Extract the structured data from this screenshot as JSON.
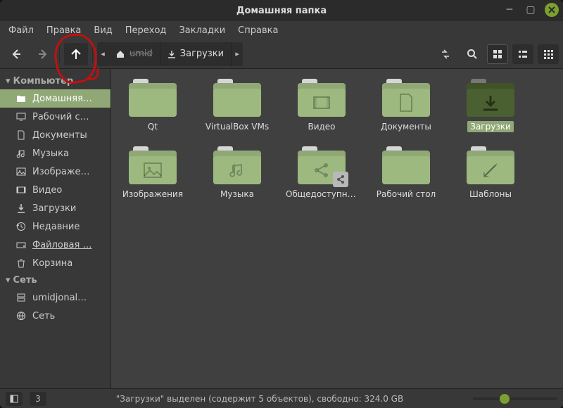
{
  "title": "Домашняя папка",
  "menu": {
    "file": "Файл",
    "edit": "Правка",
    "view": "Вид",
    "go": "Переход",
    "bookmarks": "Закладки",
    "help": "Справка"
  },
  "path": {
    "home_label": "",
    "downloads_label": "Загрузки"
  },
  "sidebar": {
    "computer_label": "Компьютер",
    "network_label": "Сеть",
    "items": [
      {
        "label": "Домашняя…",
        "icon": "folder",
        "active": true
      },
      {
        "label": "Рабочий с…",
        "icon": "desktop"
      },
      {
        "label": "Документы",
        "icon": "document"
      },
      {
        "label": "Музыка",
        "icon": "music"
      },
      {
        "label": "Изображе…",
        "icon": "image"
      },
      {
        "label": "Видео",
        "icon": "video"
      },
      {
        "label": "Загрузки",
        "icon": "download"
      },
      {
        "label": "Недавние",
        "icon": "recent"
      },
      {
        "label": "Файловая …",
        "icon": "disk",
        "underline": true
      },
      {
        "label": "Корзина",
        "icon": "trash"
      }
    ],
    "net_items": [
      {
        "label": "umidjonal…",
        "icon": "server"
      },
      {
        "label": "Сеть",
        "icon": "network"
      }
    ]
  },
  "folders": [
    {
      "label": "Qt",
      "glyph": ""
    },
    {
      "label": "VirtualBox VMs",
      "glyph": ""
    },
    {
      "label": "Видео",
      "glyph": "video"
    },
    {
      "label": "Документы",
      "glyph": "doc"
    },
    {
      "label": "Загрузки",
      "glyph": "download",
      "selected": true,
      "dark": true
    },
    {
      "label": "Изображения",
      "glyph": "image"
    },
    {
      "label": "Музыка",
      "glyph": "music"
    },
    {
      "label": "Общедоступные",
      "glyph": "share",
      "badge": "share"
    },
    {
      "label": "Рабочий стол",
      "glyph": ""
    },
    {
      "label": "Шаблоны",
      "glyph": "template"
    }
  ],
  "status": {
    "count": "3",
    "msg": "\"Загрузки\" выделен (содержит 5 объектов), свободно: 324.0 GB"
  }
}
